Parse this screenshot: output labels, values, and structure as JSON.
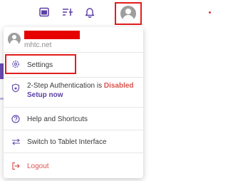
{
  "topbar": {
    "icons": [
      "calendar-icon",
      "sliders-icon",
      "bell-icon",
      "user-avatar-icon"
    ]
  },
  "user": {
    "domain": "mhtc.net"
  },
  "menu": {
    "settings": "Settings",
    "two_step_prefix": "2-Step Authentication is ",
    "two_step_status": "Disabled",
    "setup_now": "Setup now",
    "help": "Help and Shortcuts",
    "tablet": "Switch to Tablet Interface",
    "logout": "Logout"
  },
  "colors": {
    "accent_purple": "#5b3fa6",
    "danger_red": "#d9534f",
    "highlight_red": "#e21d1d",
    "redaction_red": "#e60000"
  }
}
